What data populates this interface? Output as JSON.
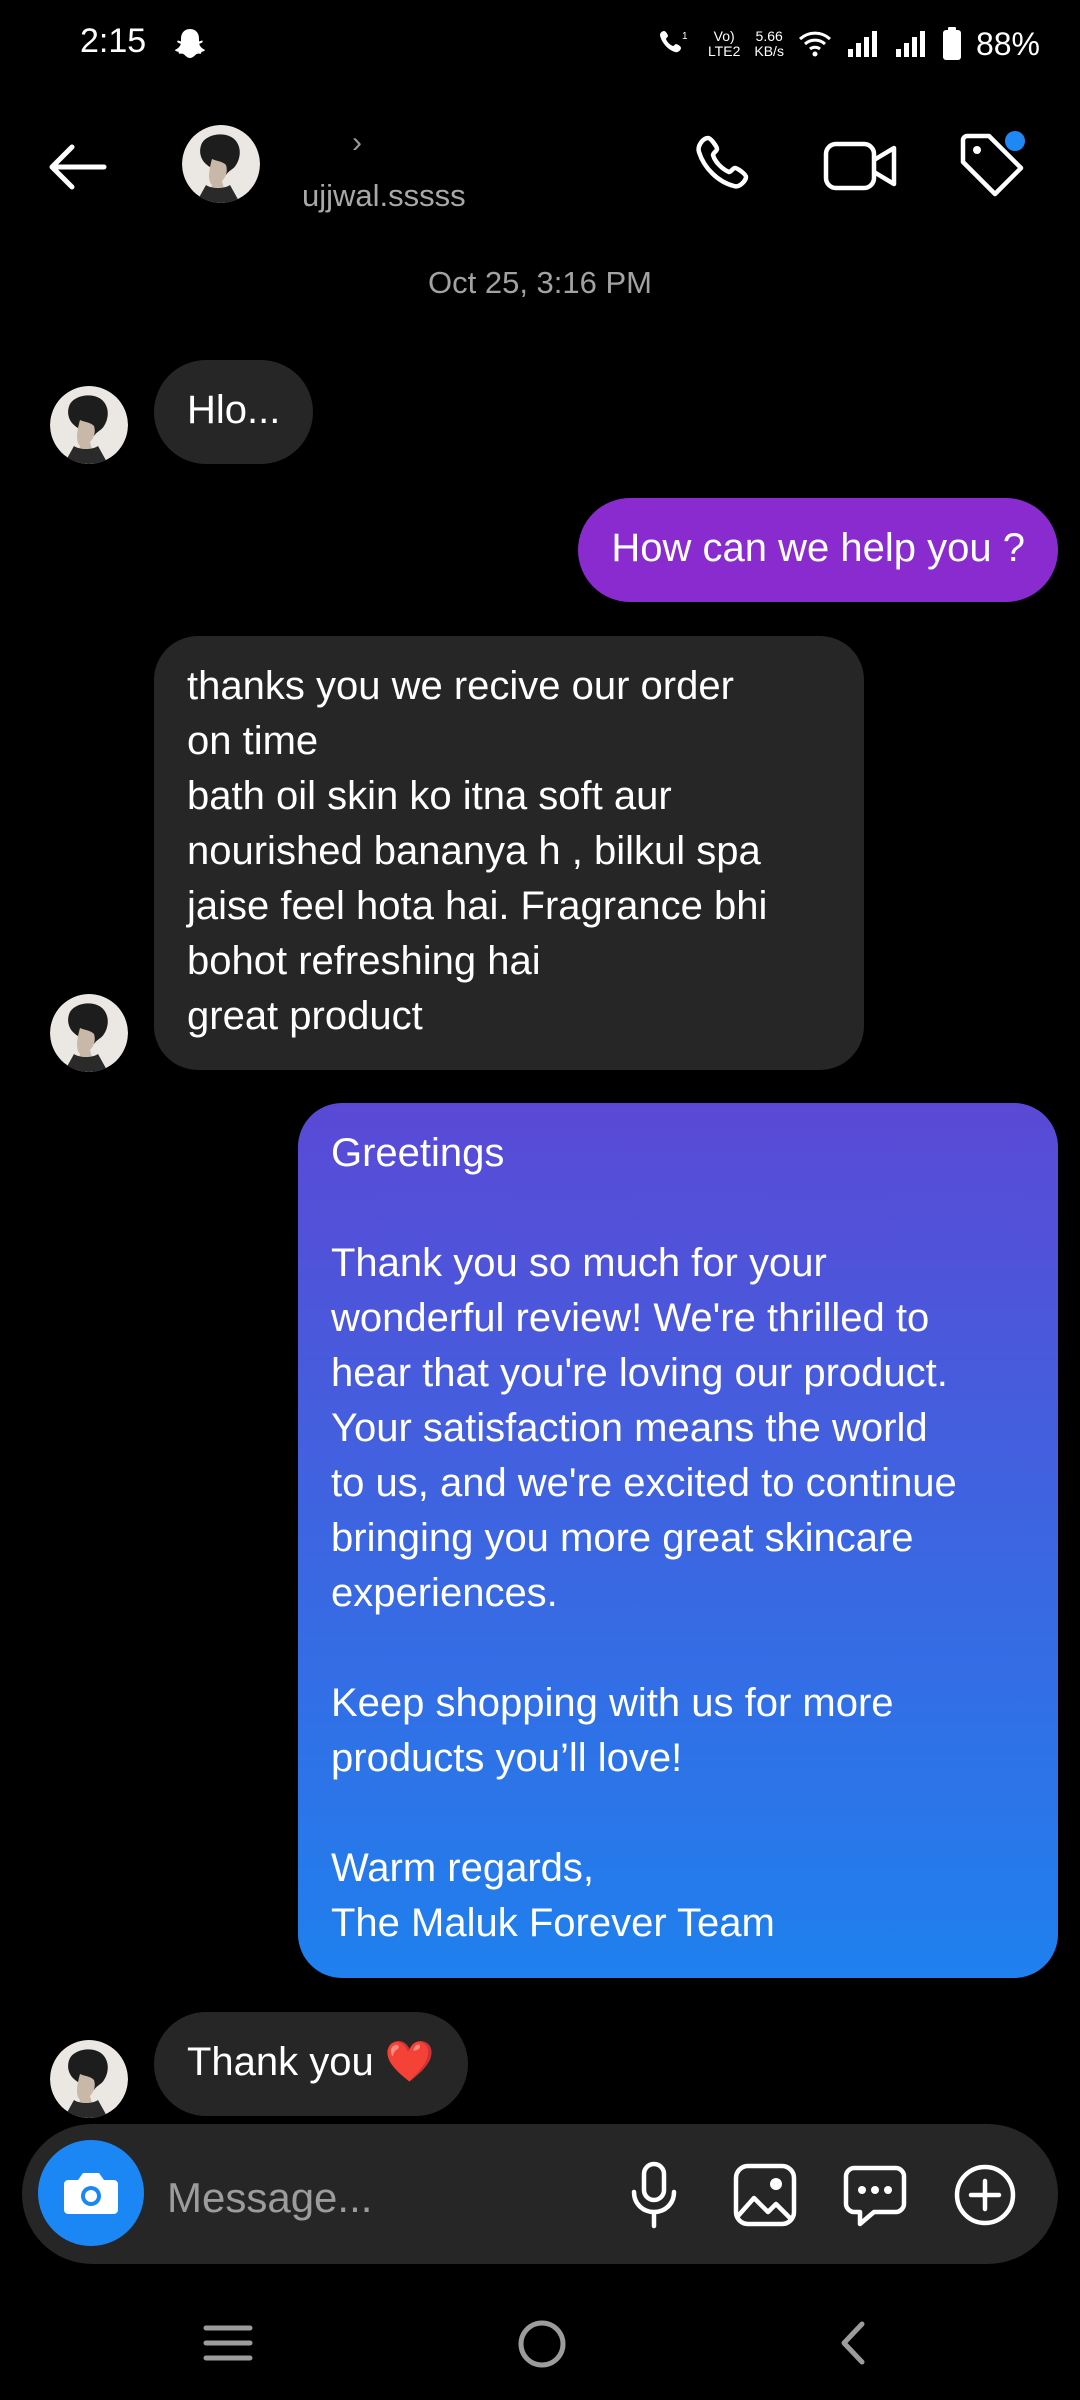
{
  "status_bar": {
    "time": "2:15",
    "volte_top": "Vo)",
    "volte_bottom": "LTE2",
    "speed_top": "5.66",
    "speed_bottom": "KB/s",
    "battery": "88%"
  },
  "header": {
    "username": "ujjwal.sssss",
    "chevron": "›"
  },
  "conversation": {
    "timestamp": "Oct 25, 3:16 PM",
    "messages": [
      {
        "from": "them",
        "text": "Hlo..."
      },
      {
        "from": "me",
        "text": "How can we help you ?"
      },
      {
        "from": "them",
        "text": "thanks you we recive our order\non time\nbath oil  skin ko itna soft aur\nnourished bananya h , bilkul spa\njaise feel hota hai. Fragrance bhi\nbohot refreshing hai\ngreat product"
      },
      {
        "from": "me",
        "text": "Greetings\n\nThank you so much for your\nwonderful review! We're thrilled to\nhear that you're loving our product.\nYour satisfaction means the world\nto us, and we're excited to continue\nbringing you more great skincare\nexperiences.\n\nKeep shopping with us for more\nproducts you’ll love!\n\nWarm regards,\nThe Maluk Forever Team"
      },
      {
        "from": "them",
        "text": "Thank you ",
        "emoji": "❤️"
      }
    ]
  },
  "composer": {
    "placeholder": "Message..."
  },
  "colors": {
    "background": "#000000",
    "incoming_bubble": "#262626",
    "outgoing_purple": "#8a2bd0",
    "outgoing_gradient_top": "#5a49d6",
    "outgoing_gradient_bottom": "#1f80ee",
    "camera_button": "#1a87f4",
    "notification_dot": "#1e88f5"
  },
  "icons": {
    "back": "arrow-left-icon",
    "call": "phone-icon",
    "video": "video-camera-icon",
    "tag": "tag-icon",
    "camera": "camera-icon",
    "mic": "microphone-icon",
    "gallery": "image-icon",
    "sticker": "sticker-chat-icon",
    "add": "plus-circle-icon"
  }
}
